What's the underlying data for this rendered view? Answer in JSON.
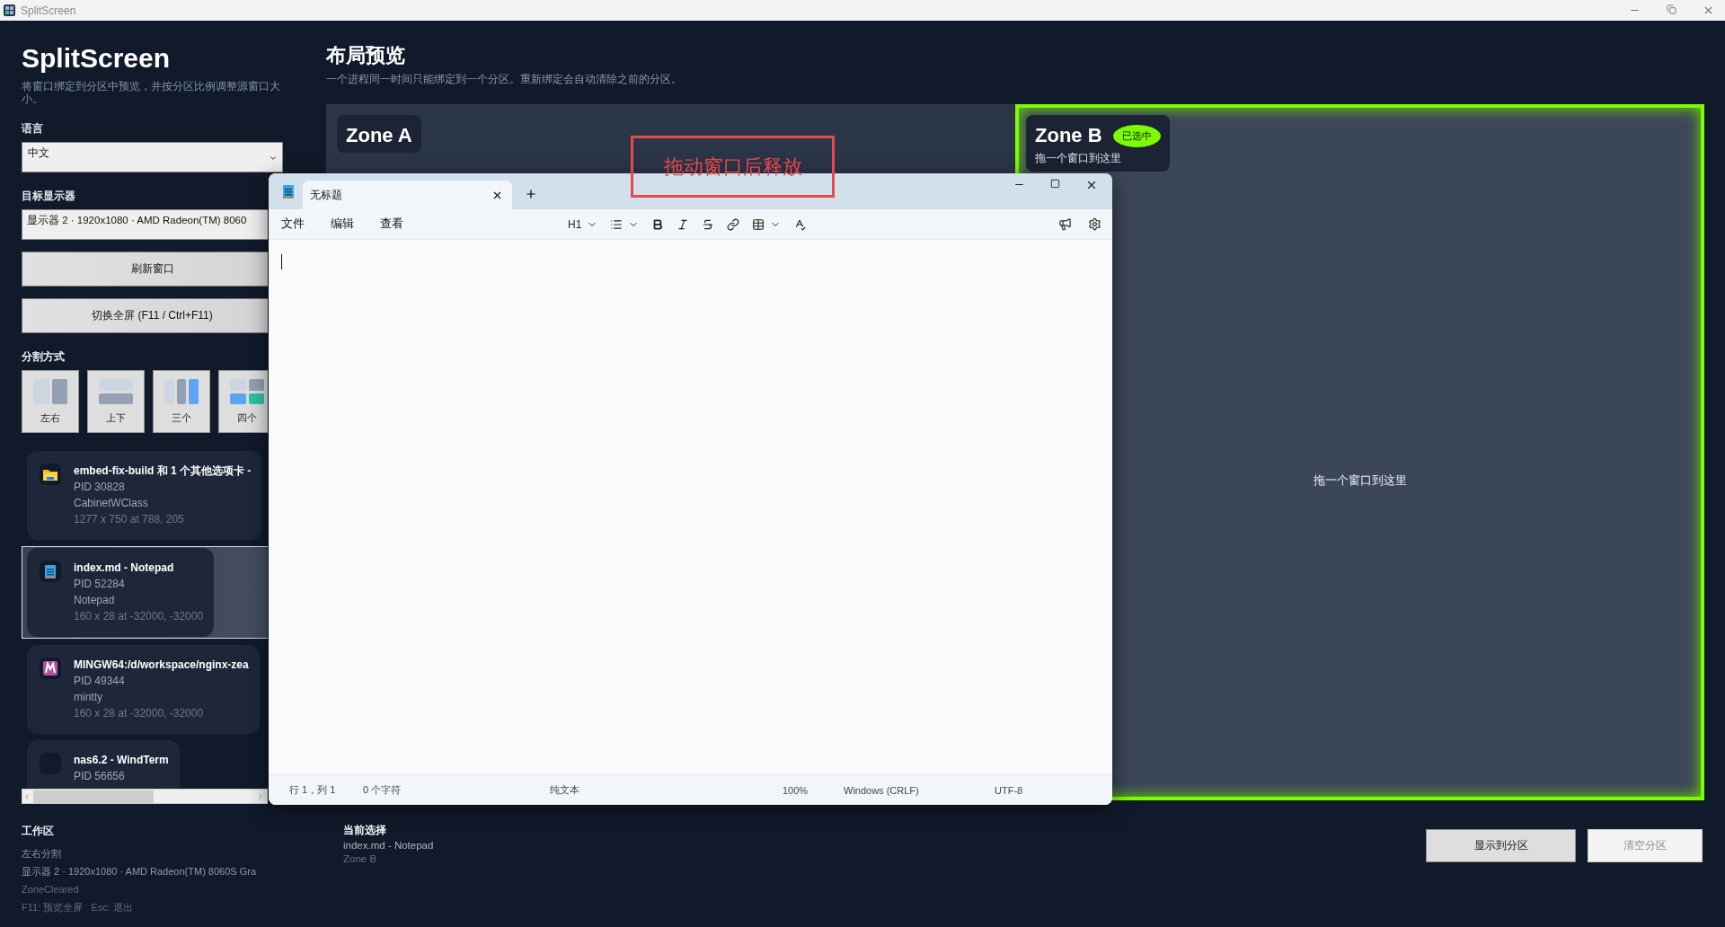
{
  "titlebar": {
    "title": "SplitScreen"
  },
  "sidebar": {
    "title": "SplitScreen",
    "description": "将窗口绑定到分区中预览，并按分区比例调整源窗口大小。",
    "language": {
      "label": "语言",
      "value": "中文"
    },
    "monitor": {
      "label": "目标显示器",
      "value": "显示器 2 · 1920x1080 · AMD Radeon(TM) 8060"
    },
    "buttons": [
      "刷新窗口",
      "切换全屏 (F11 / Ctrl+F11)"
    ],
    "layout": {
      "label": "分割方式",
      "options": [
        {
          "kind": "left-right",
          "label": "左右"
        },
        {
          "kind": "top-bottom",
          "label": "上下"
        },
        {
          "kind": "three",
          "label": "三个"
        },
        {
          "kind": "four",
          "label": "四个"
        }
      ]
    },
    "windows": [
      {
        "kind": "folder",
        "title": "embed-fix-build 和 1 个其他选项卡 -",
        "lines": [
          "PID 30828",
          "CabinetWClass",
          "1277 x 750 at 788, 205"
        ],
        "selected": false
      },
      {
        "kind": "notepad",
        "title": "index.md - Notepad",
        "lines": [
          "PID 52284",
          "Notepad",
          "160 x 28 at -32000, -32000"
        ],
        "selected": true
      },
      {
        "kind": "terminal",
        "title": "MINGW64:/d/workspace/nginx-zea",
        "lines": [
          "PID 49344",
          "mintty",
          "160 x 28 at -32000, -32000"
        ],
        "selected": false
      },
      {
        "kind": "blank",
        "title": "nas6.2 - WindTerm",
        "lines": [
          "PID 56656"
        ],
        "selected": false
      }
    ],
    "workspace": {
      "title": "工作区",
      "lines": [
        {
          "text": "左右分割",
          "dim": false
        },
        {
          "text": "显示器 2 · 1920x1080 · AMD Radeon(TM) 8060S Gra",
          "dim": false
        },
        {
          "text": "ZoneCleared",
          "dim": true
        },
        {
          "text": "F11: 预览全屏   Esc: 退出",
          "dim": true
        }
      ]
    }
  },
  "main": {
    "title": "布局预览",
    "description": "一个进程同一时间只能绑定到一个分区。重新绑定会自动清除之前的分区。",
    "zones": [
      {
        "name": "Zone A",
        "selected": false
      },
      {
        "name": "Zone B",
        "selected": true,
        "badge": "已选中",
        "hint": "拖一个窗口到这里",
        "center_text": "拖一个窗口到这里"
      }
    ],
    "drop_hint": "拖动窗口后释放",
    "current": {
      "title": "当前选择",
      "window": "index.md - Notepad",
      "zone": "Zone B"
    },
    "actions": [
      {
        "label": "显示到分区",
        "disabled": false
      },
      {
        "label": "清空分区",
        "disabled": true
      }
    ]
  },
  "notepad": {
    "tab": "无标题",
    "menu": [
      "文件",
      "编辑",
      "查看"
    ],
    "heading": "H1",
    "status": [
      "行 1，列 1",
      "0 个字符",
      "纯文本",
      "100%",
      "Windows (CRLF)",
      "UTF-8"
    ]
  }
}
